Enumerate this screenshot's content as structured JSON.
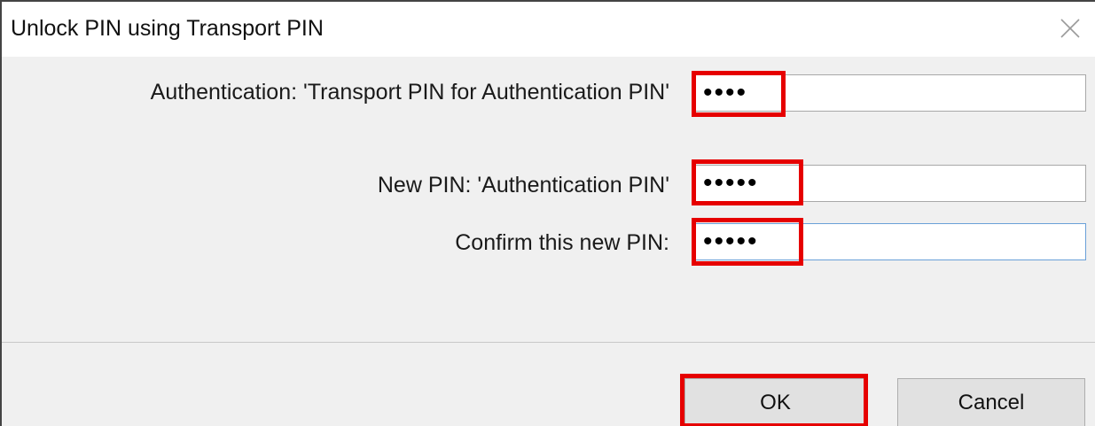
{
  "dialog": {
    "title": "Unlock PIN using Transport PIN",
    "close_icon": "close-icon"
  },
  "fields": [
    {
      "label": "Authentication: 'Transport PIN for Authentication PIN'",
      "value": "••••"
    },
    {
      "label": "New PIN: 'Authentication PIN'",
      "value": "•••••"
    },
    {
      "label": "Confirm this new PIN:",
      "value": "•••••"
    }
  ],
  "buttons": {
    "ok_label": "OK",
    "cancel_label": "Cancel"
  },
  "colors": {
    "highlight": "#e60000",
    "dialog_bg": "#f0f0f0",
    "focus_border": "#6aa0d8"
  }
}
